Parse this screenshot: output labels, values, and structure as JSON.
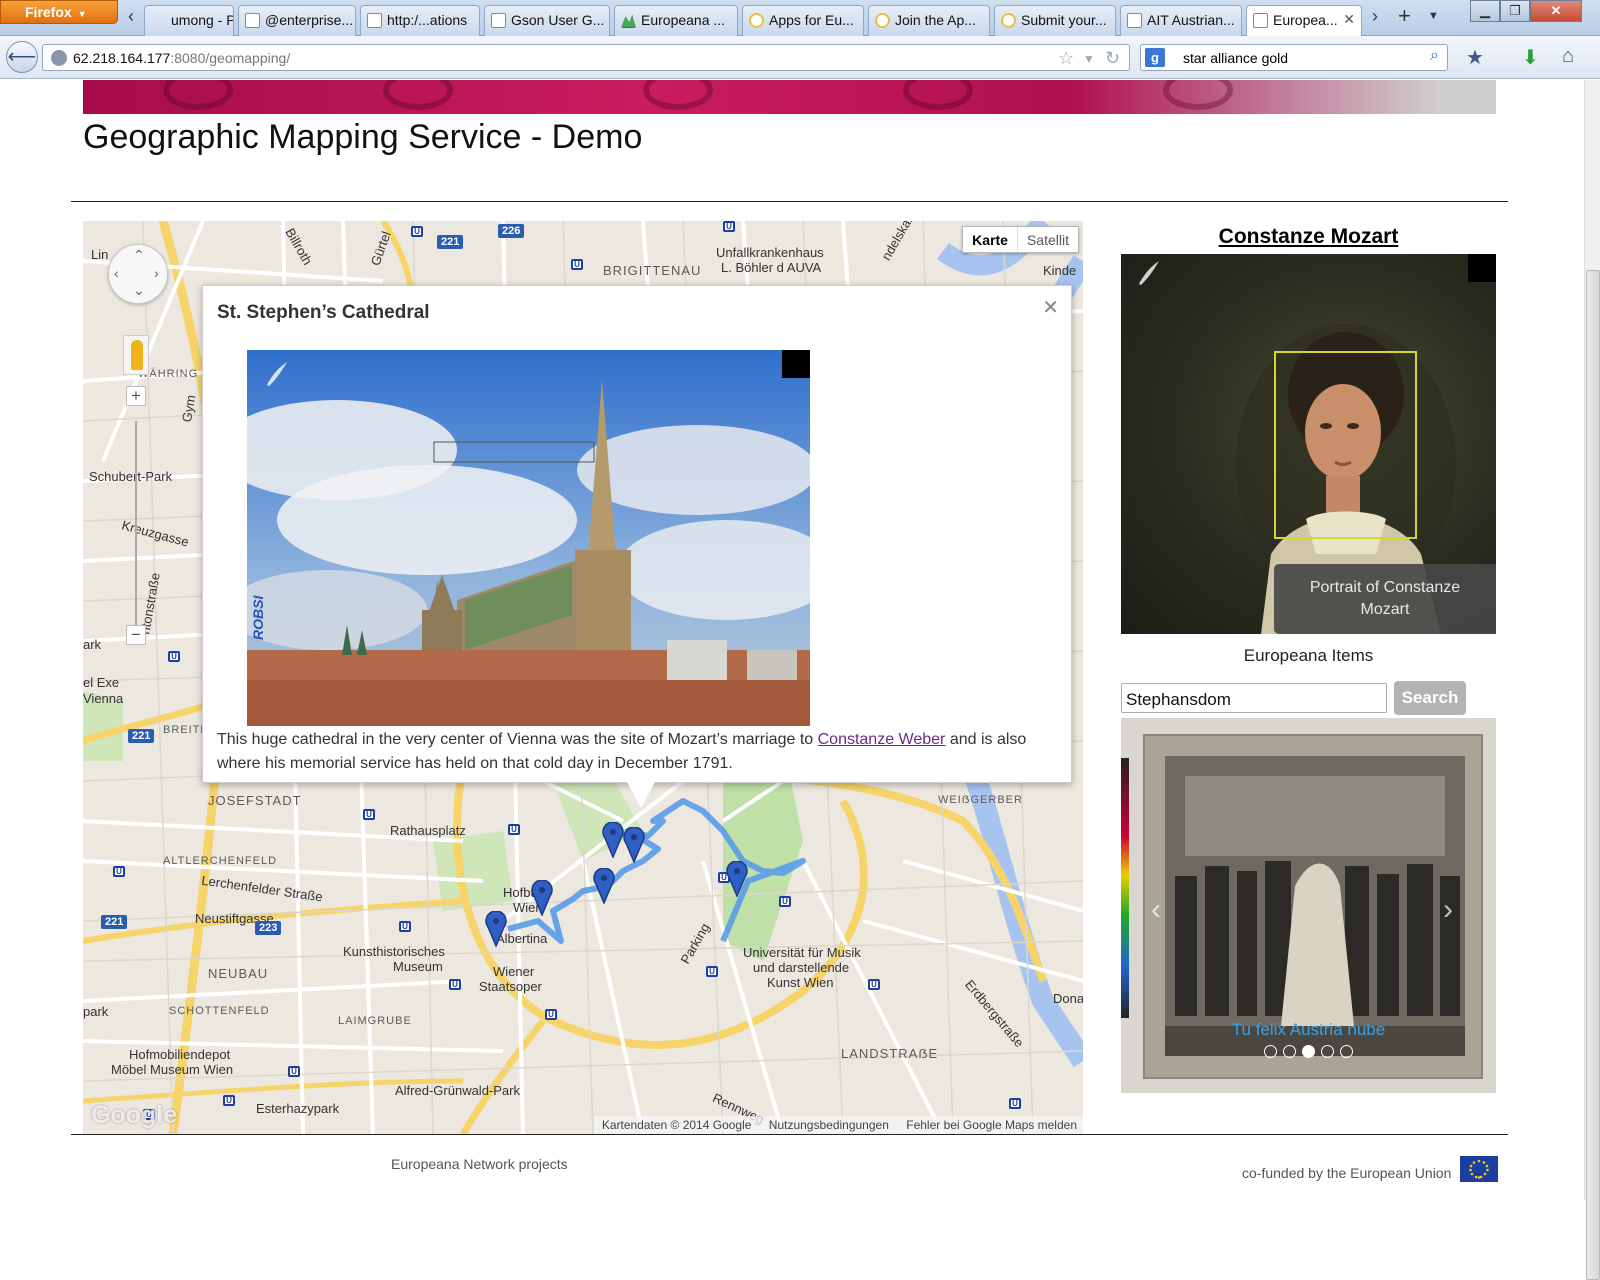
{
  "browser": {
    "firefox_label": "Firefox",
    "tabs": [
      {
        "label": "umong - Pr..."
      },
      {
        "label": "@enterprise..."
      },
      {
        "label": "http:/...ations"
      },
      {
        "label": "Gson User G..."
      },
      {
        "label": "Europeana ..."
      },
      {
        "label": "Apps for Eu..."
      },
      {
        "label": "Join the Ap..."
      },
      {
        "label": "Submit your..."
      },
      {
        "label": "AIT Austrian..."
      },
      {
        "label": "Europea..."
      }
    ],
    "url_host": "62.218.164.177",
    "url_rest": ":8080/geomapping/",
    "search_value": "star alliance gold"
  },
  "page": {
    "title": "Geographic Mapping Service - Demo"
  },
  "map": {
    "type_controls": {
      "map": "Karte",
      "satellite": "Satellit"
    },
    "labels": {
      "brigittenau": "BRIGITTENAU",
      "unfall": "Unfallkrankenhaus",
      "boehler": "L. Böhler d AUVA",
      "kinde": "Kinde",
      "lin": "Lin",
      "billroth": "Billroth",
      "gurtel": "Gürtel",
      "ndelskai": "ndelskai",
      "waehring": "WÄHRING",
      "gym": "Gym",
      "schubert": "Schubert-Park",
      "kreuzgasse": "Kreuzgasse",
      "antonstrasse": "ntonstraße",
      "ark": "ark",
      "exe": "el Exe",
      "vienna": "Vienna",
      "breite": "BREITE",
      "josefstadt": "JOSEFSTADT",
      "rathausplatz": "Rathausplatz",
      "weissgerber": "WEIẞGERBER",
      "altlerchenfeld": "ALTLERCHENFELD",
      "lerchenfelder": "Lerchenfelder Straße",
      "neustiftgasse": "Neustiftgasse",
      "hofburg": "Hofburg",
      "wien": "Wien",
      "albertina": "Albertina",
      "khm1": "Kunsthistorisches",
      "khm2": "Museum",
      "staatsoper1": "Wiener",
      "staatsoper2": "Staatsoper",
      "neubau": "NEUBAU",
      "parking": "Parking",
      "uni1": "Universität für Musik",
      "uni2": "und darstellende",
      "uni3": "Kunst Wien",
      "schottenfeld": "SCHOTTENFELD",
      "laimgrube": "LAIMGRUBE",
      "park": "park",
      "dona": "Dona",
      "erdberg": "Erdbergstraße",
      "landstrasse": "LANDSTRAẞE",
      "hofmobilien1": "Hofmobiliendepot",
      "hofmobilien2": "Möbel Museum Wien",
      "gruenwald": "Alfred-Grünwald-Park",
      "esterhazy": "Esterhazypark",
      "rennweg": "Rennweg"
    },
    "shields": [
      "221",
      "226",
      "221",
      "223",
      "221"
    ],
    "google_logo": "Google",
    "footer": {
      "data": "Kartendaten © 2014 Google",
      "terms": "Nutzungsbedingungen",
      "report": "Fehler bei Google Maps melden"
    },
    "info_window": {
      "title": "St. Stephen’s Cathedral",
      "desc_before": "This huge cathedral in the very center of Vienna was the site of Mozart’s marriage to ",
      "desc_link": "Constanze Weber",
      "desc_after": " and is also where his memorial service has held on that cold day in December 1791.",
      "photo_watermark": "ROBSI"
    }
  },
  "sidebar": {
    "person_name": "Constanze Mozart",
    "portrait_tooltip": "Portrait of Constanze Mozart",
    "items_label": "Europeana Items",
    "search_value": "Stephansdom",
    "search_button": "Search",
    "carousel_caption": "Tu felix Austria nube",
    "carousel_active_index": 3,
    "carousel_count": 5
  },
  "footer": {
    "left": "Europeana Network projects",
    "right": "co-funded by the European Union"
  },
  "colors": {
    "route": "#5b9be8",
    "pin": "#2f5fc4",
    "banner": "#b5134f",
    "tooltip": "#464646",
    "caption": "#3ba0e6"
  }
}
